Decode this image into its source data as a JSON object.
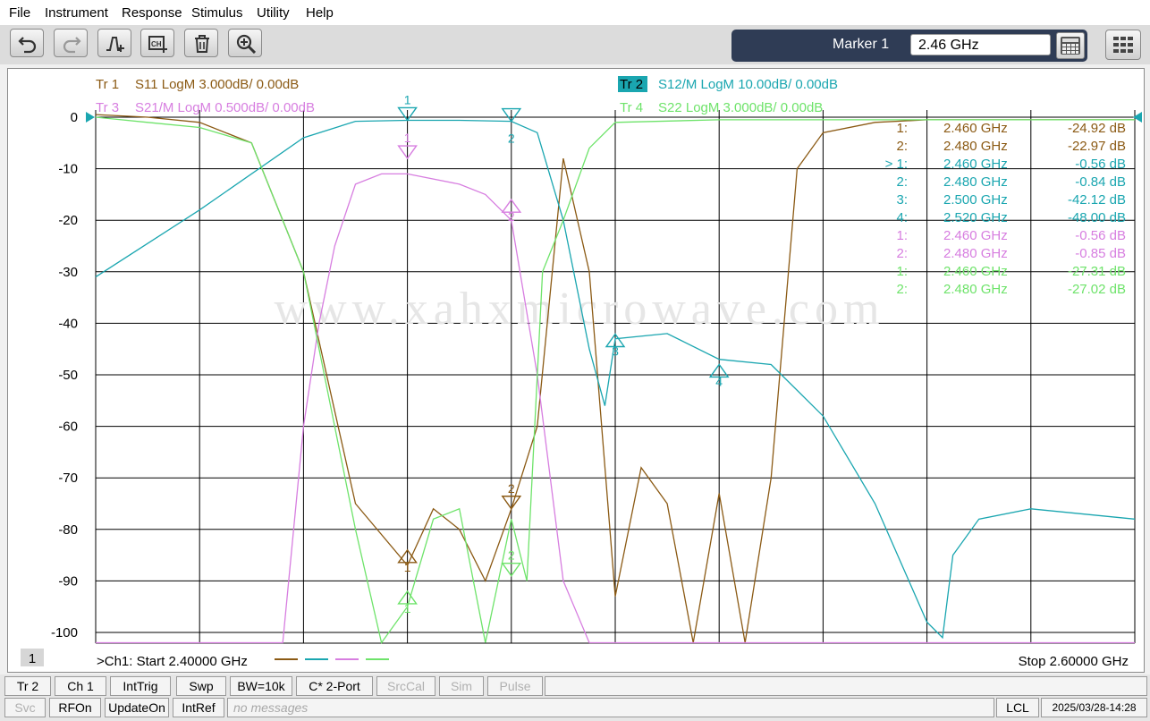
{
  "menu": [
    "File",
    "Instrument",
    "Response",
    "Stimulus",
    "Utility",
    "Help"
  ],
  "toolbar": {
    "buttons": [
      "undo-icon",
      "redo-icon",
      "add-marker-icon",
      "add-channel-icon",
      "delete-icon",
      "zoom-icon"
    ]
  },
  "marker_panel": {
    "label": "Marker 1",
    "value": "2.46 GHz"
  },
  "traces": [
    {
      "tag": "Tr  1",
      "text": "S11 LogM 3.000dB/  0.00dB",
      "color": "#8b5a14"
    },
    {
      "tag": "Tr  2",
      "text": "S12/M LogM 10.00dB/  0.00dB",
      "color": "#1aa6b0"
    },
    {
      "tag": "Tr  3",
      "text": "S21/M LogM 0.500dB/  0.00dB",
      "color": "#d77ee0"
    },
    {
      "tag": "Tr  4",
      "text": "S22 LogM 3.000dB/  0.00dB",
      "color": "#6ee36a"
    }
  ],
  "watermark": "www.xahxmicrowave.com",
  "marker_table": [
    {
      "id": "1:",
      "freq": "2.460  GHz",
      "val": "-24.92 dB",
      "color": "#8b5a14"
    },
    {
      "id": "2:",
      "freq": "2.480  GHz",
      "val": "-22.97 dB",
      "color": "#8b5a14"
    },
    {
      "id": "> 1:",
      "freq": "2.460  GHz",
      "val": "-0.56 dB",
      "color": "#1aa6b0"
    },
    {
      "id": "2:",
      "freq": "2.480  GHz",
      "val": "-0.84 dB",
      "color": "#1aa6b0"
    },
    {
      "id": "3:",
      "freq": "2.500  GHz",
      "val": "-42.12 dB",
      "color": "#1aa6b0"
    },
    {
      "id": "4:",
      "freq": "2.520  GHz",
      "val": "-48.00 dB",
      "color": "#1aa6b0"
    },
    {
      "id": "1:",
      "freq": "2.460  GHz",
      "val": "-0.56 dB",
      "color": "#d77ee0"
    },
    {
      "id": "2:",
      "freq": "2.480  GHz",
      "val": "-0.85 dB",
      "color": "#d77ee0"
    },
    {
      "id": "1:",
      "freq": "2.460  GHz",
      "val": "-27.31 dB",
      "color": "#6ee36a"
    },
    {
      "id": "2:",
      "freq": "2.480  GHz",
      "val": "-27.02 dB",
      "color": "#6ee36a"
    }
  ],
  "chart_data": {
    "type": "line",
    "x_unit": "GHz",
    "xlim": [
      2.4,
      2.6
    ],
    "ylim": [
      -102,
      2
    ],
    "yticks": [
      0,
      -10,
      -20,
      -30,
      -40,
      -50,
      -60,
      -70,
      -80,
      -90,
      -100
    ],
    "ytick_labels": [
      "0",
      "-10",
      "-20",
      "-30",
      "-40",
      "-50",
      "-60",
      "-70",
      "-80",
      "-90",
      "-100"
    ],
    "grid": true,
    "start_label": ">Ch1:  Start   2.40000 GHz",
    "stop_label": "Stop  2.60000 GHz",
    "channel_badge": "1",
    "series": [
      {
        "name": "S11",
        "color": "#8b5a14",
        "x": [
          2.4,
          2.41,
          2.42,
          2.43,
          2.44,
          2.45,
          2.46,
          2.465,
          2.47,
          2.475,
          2.48,
          2.485,
          2.49,
          2.495,
          2.5,
          2.505,
          2.51,
          2.515,
          2.52,
          2.525,
          2.53,
          2.535,
          2.54,
          2.55,
          2.56,
          2.58,
          2.6
        ],
        "y": [
          0.5,
          0,
          -1,
          -5,
          -30,
          -75,
          -87,
          -76,
          -80,
          -90,
          -76,
          -60,
          -8,
          -30,
          -93,
          -68,
          -75,
          -102,
          -73,
          -102,
          -70,
          -10,
          -3,
          -1,
          -0.5,
          -0.5,
          -0.5
        ]
      },
      {
        "name": "S12",
        "color": "#1aa6b0",
        "x": [
          2.4,
          2.42,
          2.44,
          2.45,
          2.46,
          2.47,
          2.48,
          2.485,
          2.49,
          2.495,
          2.498,
          2.5,
          2.51,
          2.52,
          2.53,
          2.54,
          2.55,
          2.56,
          2.563,
          2.565,
          2.57,
          2.58,
          2.6
        ],
        "y": [
          -31,
          -18,
          -4,
          -0.8,
          -0.6,
          -0.6,
          -0.8,
          -3,
          -20,
          -45,
          -56,
          -43,
          -42,
          -47,
          -48,
          -58,
          -75,
          -98,
          -101,
          -85,
          -78,
          -76,
          -78
        ]
      },
      {
        "name": "S21",
        "color": "#d77ee0",
        "x": [
          2.4,
          2.436,
          2.44,
          2.443,
          2.446,
          2.45,
          2.455,
          2.46,
          2.47,
          2.475,
          2.48,
          2.485,
          2.49,
          2.495,
          2.6
        ],
        "y": [
          -102,
          -102,
          -60,
          -40,
          -25,
          -13,
          -11,
          -11,
          -13,
          -15,
          -20,
          -50,
          -90,
          -102,
          -102
        ]
      },
      {
        "name": "S22",
        "color": "#6ee36a",
        "x": [
          2.4,
          2.41,
          2.42,
          2.43,
          2.44,
          2.45,
          2.455,
          2.46,
          2.465,
          2.47,
          2.475,
          2.48,
          2.483,
          2.486,
          2.49,
          2.495,
          2.5,
          2.52,
          2.54,
          2.6
        ],
        "y": [
          0,
          -1,
          -2,
          -5,
          -30,
          -80,
          -102,
          -95,
          -78,
          -76,
          -102,
          -78,
          -90,
          -30,
          -20,
          -6,
          -1,
          -0.5,
          -0.5,
          -0.5
        ]
      }
    ],
    "markers": [
      {
        "label": "1",
        "x": 2.46,
        "y": -0.6,
        "series": "S12",
        "color": "#1aa6b0",
        "dir": "down",
        "text_pos": "above"
      },
      {
        "label": "2",
        "x": 2.48,
        "y": -0.8,
        "series": "S12",
        "color": "#1aa6b0",
        "dir": "down",
        "text_pos": "below"
      },
      {
        "label": "3",
        "x": 2.5,
        "y": -42.1,
        "series": "S12",
        "color": "#1aa6b0",
        "dir": "up",
        "text_pos": "below"
      },
      {
        "label": "4",
        "x": 2.52,
        "y": -48.0,
        "series": "S12",
        "color": "#1aa6b0",
        "dir": "up",
        "text_pos": "below"
      },
      {
        "label": "1",
        "x": 2.46,
        "y": -8,
        "series": "S21",
        "color": "#d77ee0",
        "dir": "down",
        "text_pos": "above"
      },
      {
        "label": "2",
        "x": 2.48,
        "y": -16,
        "series": "S21",
        "color": "#d77ee0",
        "dir": "up",
        "text_pos": "below"
      },
      {
        "label": "1",
        "x": 2.46,
        "y": -84,
        "series": "S11",
        "color": "#8b5a14",
        "dir": "up",
        "text_pos": "below"
      },
      {
        "label": "2",
        "x": 2.48,
        "y": -76,
        "series": "S11",
        "color": "#8b5a14",
        "dir": "down",
        "text_pos": "above"
      },
      {
        "label": "1",
        "x": 2.46,
        "y": -92,
        "series": "S22",
        "color": "#6ee36a",
        "dir": "up",
        "text_pos": "below"
      },
      {
        "label": "2",
        "x": 2.48,
        "y": -89,
        "series": "S22",
        "color": "#6ee36a",
        "dir": "down",
        "text_pos": "above"
      }
    ]
  },
  "status_row1": [
    {
      "label": "Tr 2",
      "enabled": true
    },
    {
      "label": "Ch 1",
      "enabled": true
    },
    {
      "label": "IntTrig",
      "enabled": true
    },
    {
      "label": "Swp",
      "enabled": true
    },
    {
      "label": "BW=10k",
      "enabled": true
    },
    {
      "label": "C* 2-Port",
      "enabled": true
    },
    {
      "label": "SrcCal",
      "enabled": false
    },
    {
      "label": "Sim",
      "enabled": false
    },
    {
      "label": "Pulse",
      "enabled": false
    }
  ],
  "status_row2": [
    {
      "label": "Svc",
      "enabled": false
    },
    {
      "label": "RFOn",
      "enabled": true
    },
    {
      "label": "UpdateOn",
      "enabled": true
    },
    {
      "label": "IntRef",
      "enabled": true
    }
  ],
  "status_message": "no messages",
  "status_lcl": "LCL",
  "status_datetime": "2025/03/28-14:28"
}
